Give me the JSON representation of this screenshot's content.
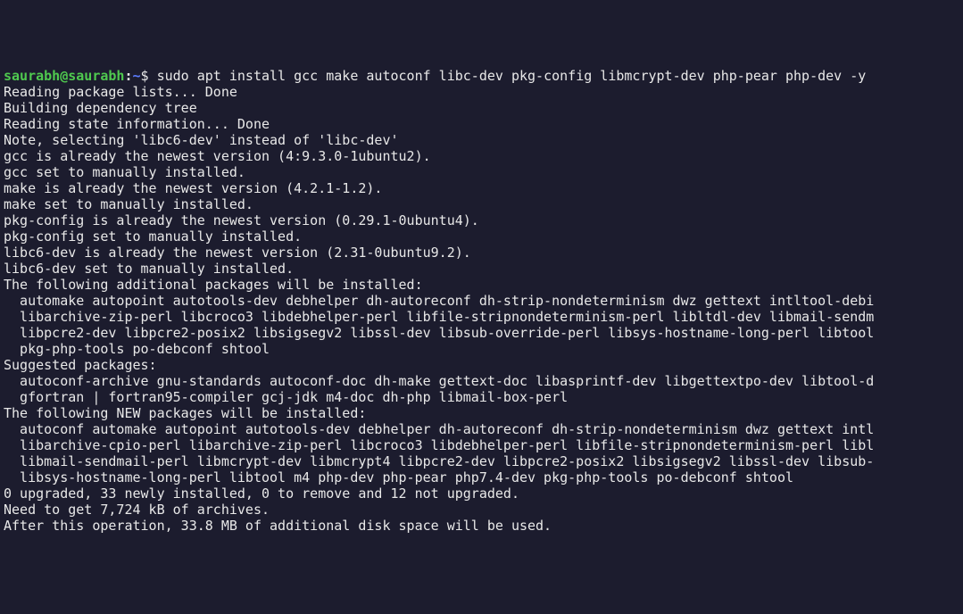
{
  "prompt": {
    "user_host": "saurabh@saurabh",
    "colon": ":",
    "path": "~",
    "dollar": "$ "
  },
  "command": "sudo apt install gcc make autoconf libc-dev pkg-config libmcrypt-dev php-pear php-dev -y",
  "output": [
    "Reading package lists... Done",
    "Building dependency tree",
    "Reading state information... Done",
    "Note, selecting 'libc6-dev' instead of 'libc-dev'",
    "gcc is already the newest version (4:9.3.0-1ubuntu2).",
    "gcc set to manually installed.",
    "make is already the newest version (4.2.1-1.2).",
    "make set to manually installed.",
    "pkg-config is already the newest version (0.29.1-0ubuntu4).",
    "pkg-config set to manually installed.",
    "libc6-dev is already the newest version (2.31-0ubuntu9.2).",
    "libc6-dev set to manually installed.",
    "The following additional packages will be installed:",
    "  automake autopoint autotools-dev debhelper dh-autoreconf dh-strip-nondeterminism dwz gettext intltool-debi",
    "  libarchive-zip-perl libcroco3 libdebhelper-perl libfile-stripnondeterminism-perl libltdl-dev libmail-sendm",
    "  libpcre2-dev libpcre2-posix2 libsigsegv2 libssl-dev libsub-override-perl libsys-hostname-long-perl libtool",
    "  pkg-php-tools po-debconf shtool",
    "Suggested packages:",
    "  autoconf-archive gnu-standards autoconf-doc dh-make gettext-doc libasprintf-dev libgettextpo-dev libtool-d",
    "  gfortran | fortran95-compiler gcj-jdk m4-doc dh-php libmail-box-perl",
    "The following NEW packages will be installed:",
    "  autoconf automake autopoint autotools-dev debhelper dh-autoreconf dh-strip-nondeterminism dwz gettext intl",
    "  libarchive-cpio-perl libarchive-zip-perl libcroco3 libdebhelper-perl libfile-stripnondeterminism-perl libl",
    "  libmail-sendmail-perl libmcrypt-dev libmcrypt4 libpcre2-dev libpcre2-posix2 libsigsegv2 libssl-dev libsub-",
    "  libsys-hostname-long-perl libtool m4 php-dev php-pear php7.4-dev pkg-php-tools po-debconf shtool",
    "0 upgraded, 33 newly installed, 0 to remove and 12 not upgraded.",
    "Need to get 7,724 kB of archives.",
    "After this operation, 33.8 MB of additional disk space will be used."
  ]
}
